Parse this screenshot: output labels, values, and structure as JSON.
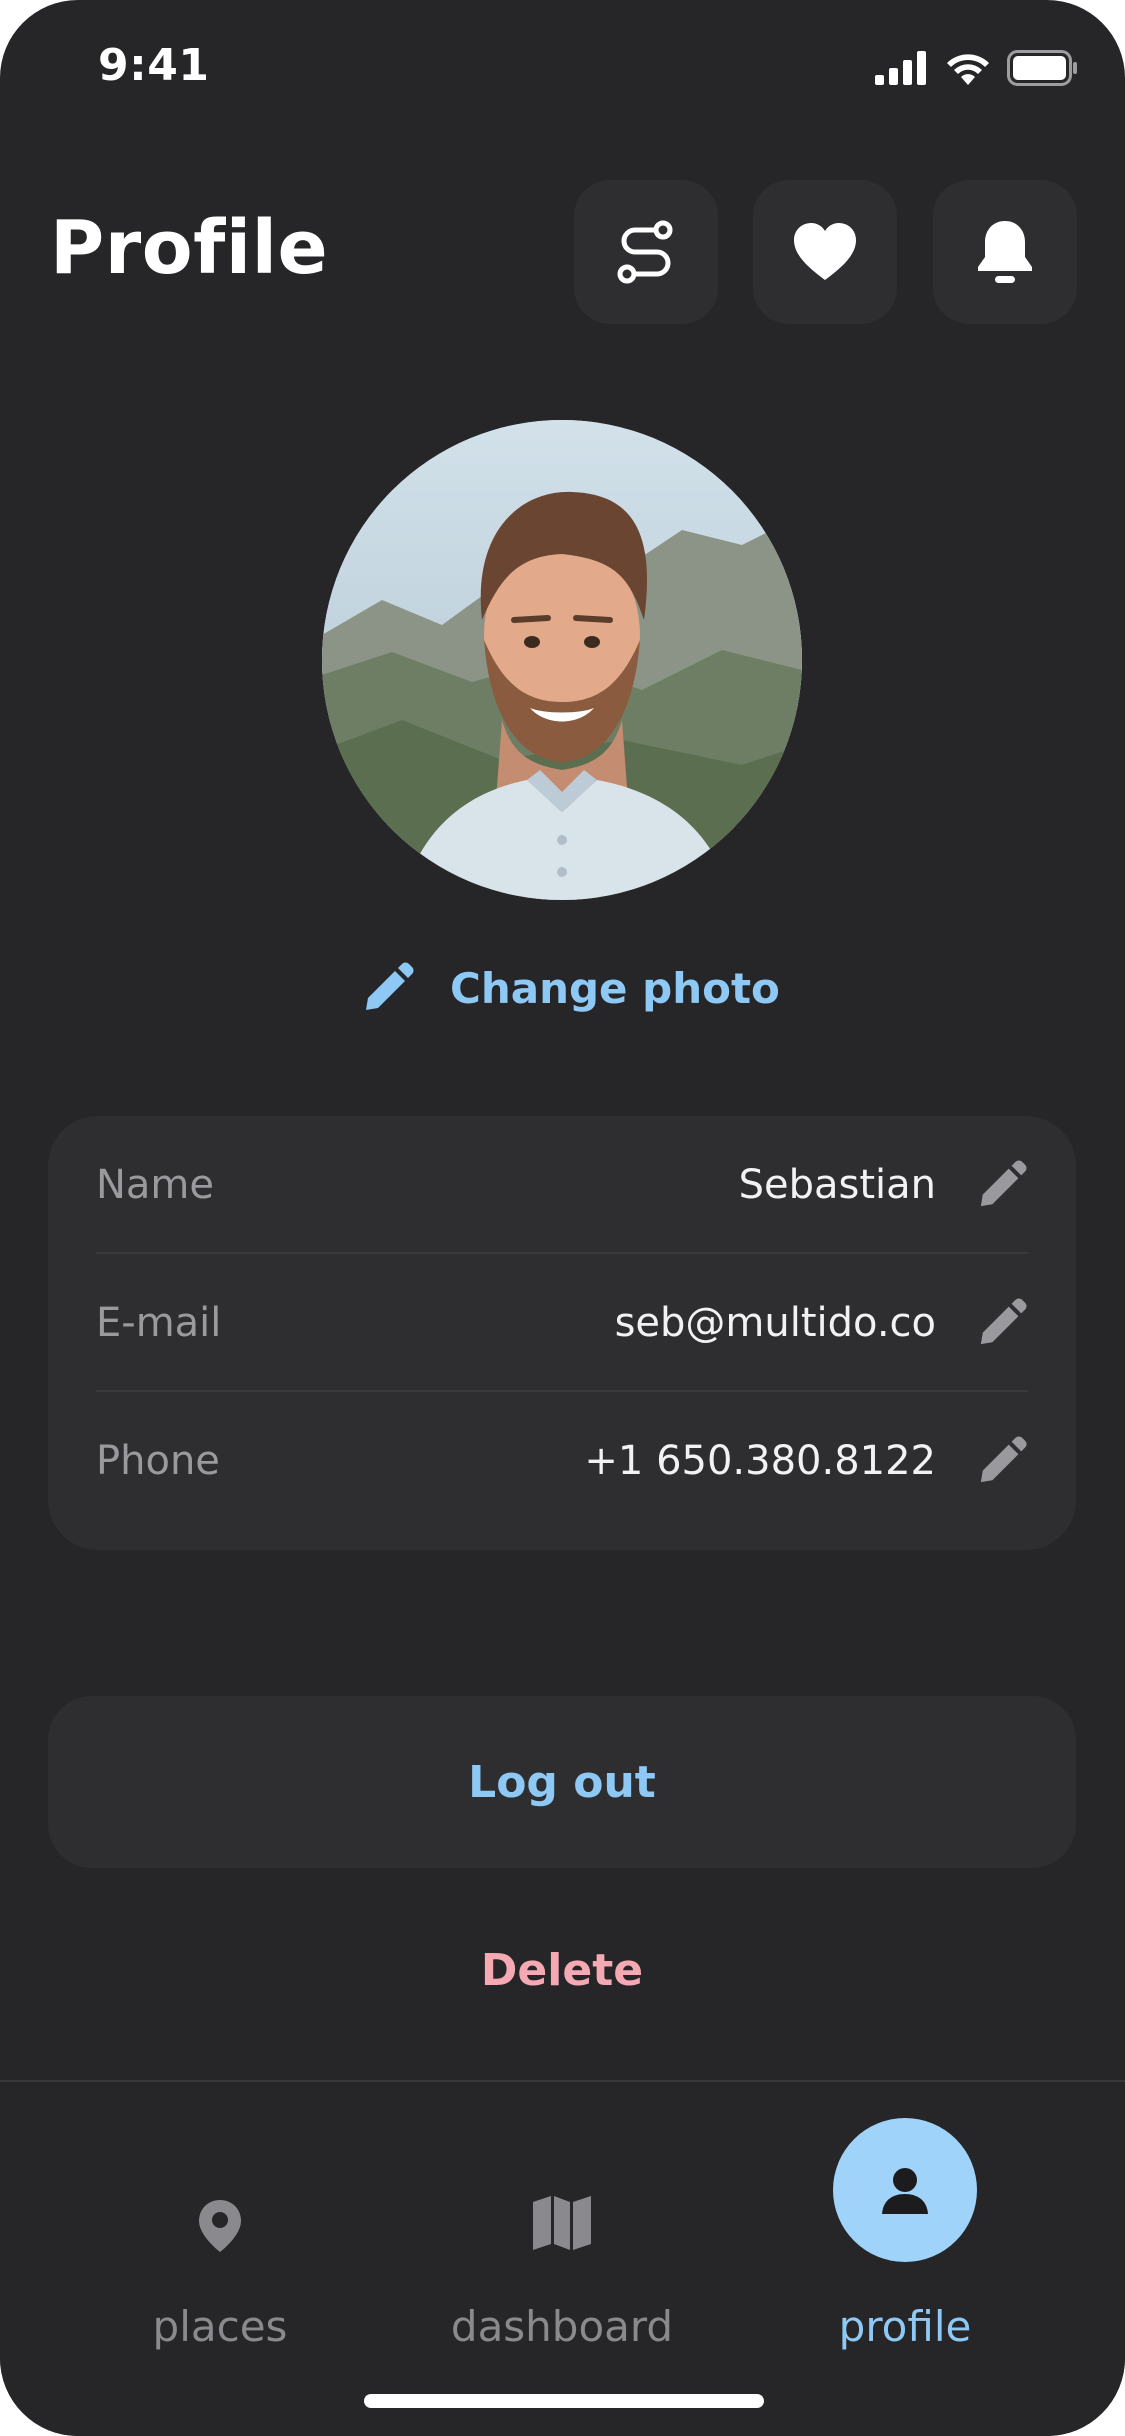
{
  "status_bar": {
    "time": "9:41",
    "icons": [
      "cellular-signal-icon",
      "wifi-icon",
      "battery-icon"
    ]
  },
  "header": {
    "title": "Profile",
    "actions": [
      {
        "name": "routes-icon"
      },
      {
        "name": "heart-icon"
      },
      {
        "name": "bell-icon"
      }
    ]
  },
  "profile": {
    "change_photo_label": "Change photo",
    "fields": [
      {
        "label": "Name",
        "value": "Sebastian"
      },
      {
        "label": "E-mail",
        "value": "seb@multido.co"
      },
      {
        "label": "Phone",
        "value": "+1 650.380.8122"
      }
    ]
  },
  "actions": {
    "logout_label": "Log out",
    "delete_label": "Delete"
  },
  "tab_bar": {
    "tabs": [
      {
        "label": "places",
        "icon": "map-pin-icon",
        "active": false
      },
      {
        "label": "dashboard",
        "icon": "map-icon",
        "active": false
      },
      {
        "label": "profile",
        "icon": "user-icon",
        "active": true
      }
    ]
  },
  "colors": {
    "background": "#262628",
    "card": "#2e2e31",
    "accent": "#8ec9f5",
    "danger": "#f4a9b3",
    "muted_text": "#9a9a9e"
  }
}
